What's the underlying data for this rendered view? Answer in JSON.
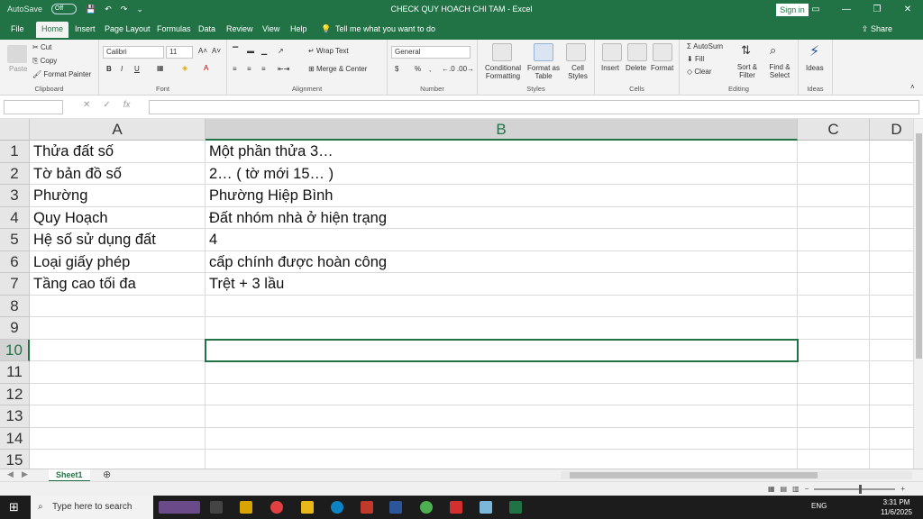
{
  "titlebar": {
    "autosave_label": "AutoSave",
    "autosave_state": "Off",
    "title": "CHECK QUY HOACH CHI TAM  -  Excel",
    "signin": "Sign in"
  },
  "tabs": [
    "File",
    "Home",
    "Insert",
    "Page Layout",
    "Formulas",
    "Data",
    "Review",
    "View",
    "Help"
  ],
  "tell_me": "Tell me what you want to do",
  "share": "Share",
  "ribbon": {
    "clipboard": {
      "paste": "Paste",
      "cut": "Cut",
      "copy": "Copy",
      "format_painter": "Format Painter",
      "label": "Clipboard"
    },
    "font": {
      "name": "Calibri",
      "size": "11",
      "bold": "B",
      "italic": "I",
      "underline": "U",
      "label": "Font"
    },
    "alignment": {
      "wrap": "Wrap Text",
      "merge": "Merge & Center",
      "label": "Alignment"
    },
    "number": {
      "format": "General",
      "currency": "$",
      "percent": "%",
      "comma": ",",
      "label": "Number"
    },
    "styles": {
      "conditional": "Conditional Formatting",
      "format_table": "Format as Table",
      "cell_styles": "Cell Styles",
      "label": "Styles"
    },
    "cells": {
      "insert": "Insert",
      "delete": "Delete",
      "format": "Format",
      "label": "Cells"
    },
    "editing": {
      "autosum": "AutoSum",
      "fill": "Fill",
      "clear": "Clear",
      "sort": "Sort & Filter",
      "find": "Find & Select",
      "label": "Editing"
    },
    "ideas": {
      "ideas": "Ideas",
      "label": "Ideas"
    }
  },
  "formula_bar": {
    "fx": "fx",
    "cancel": "✕",
    "enter": "✓"
  },
  "columns": [
    "A",
    "B",
    "C",
    "D"
  ],
  "rows": [
    "1",
    "2",
    "3",
    "4",
    "5",
    "6",
    "7",
    "8",
    "9",
    "10",
    "11",
    "12",
    "13",
    "14",
    "15"
  ],
  "cells": [
    {
      "a": "Thửa đất số",
      "b": "Một phần thửa 3…"
    },
    {
      "a": "Tờ bản đồ số",
      "b": "2… ( tờ mới 15… )"
    },
    {
      "a": "Phường",
      "b": "Phường Hiệp Bình"
    },
    {
      "a": "Quy Hoạch",
      "b": "Đất nhóm nhà ở hiện trạng"
    },
    {
      "a": "Hệ số sử dụng đất",
      "b": "4"
    },
    {
      "a": "Loại giấy phép",
      "b": "cấp chính được hoàn công"
    },
    {
      "a": "Tầng cao tối đa",
      "b": "Trệt + 3 lầu"
    }
  ],
  "sheet_tab": "Sheet1",
  "taskbar": {
    "search": "Type here to search",
    "lang": "ENG",
    "time": "3:31 PM",
    "date": "11/6/2025"
  },
  "colors": {
    "excel_green": "#217346"
  }
}
